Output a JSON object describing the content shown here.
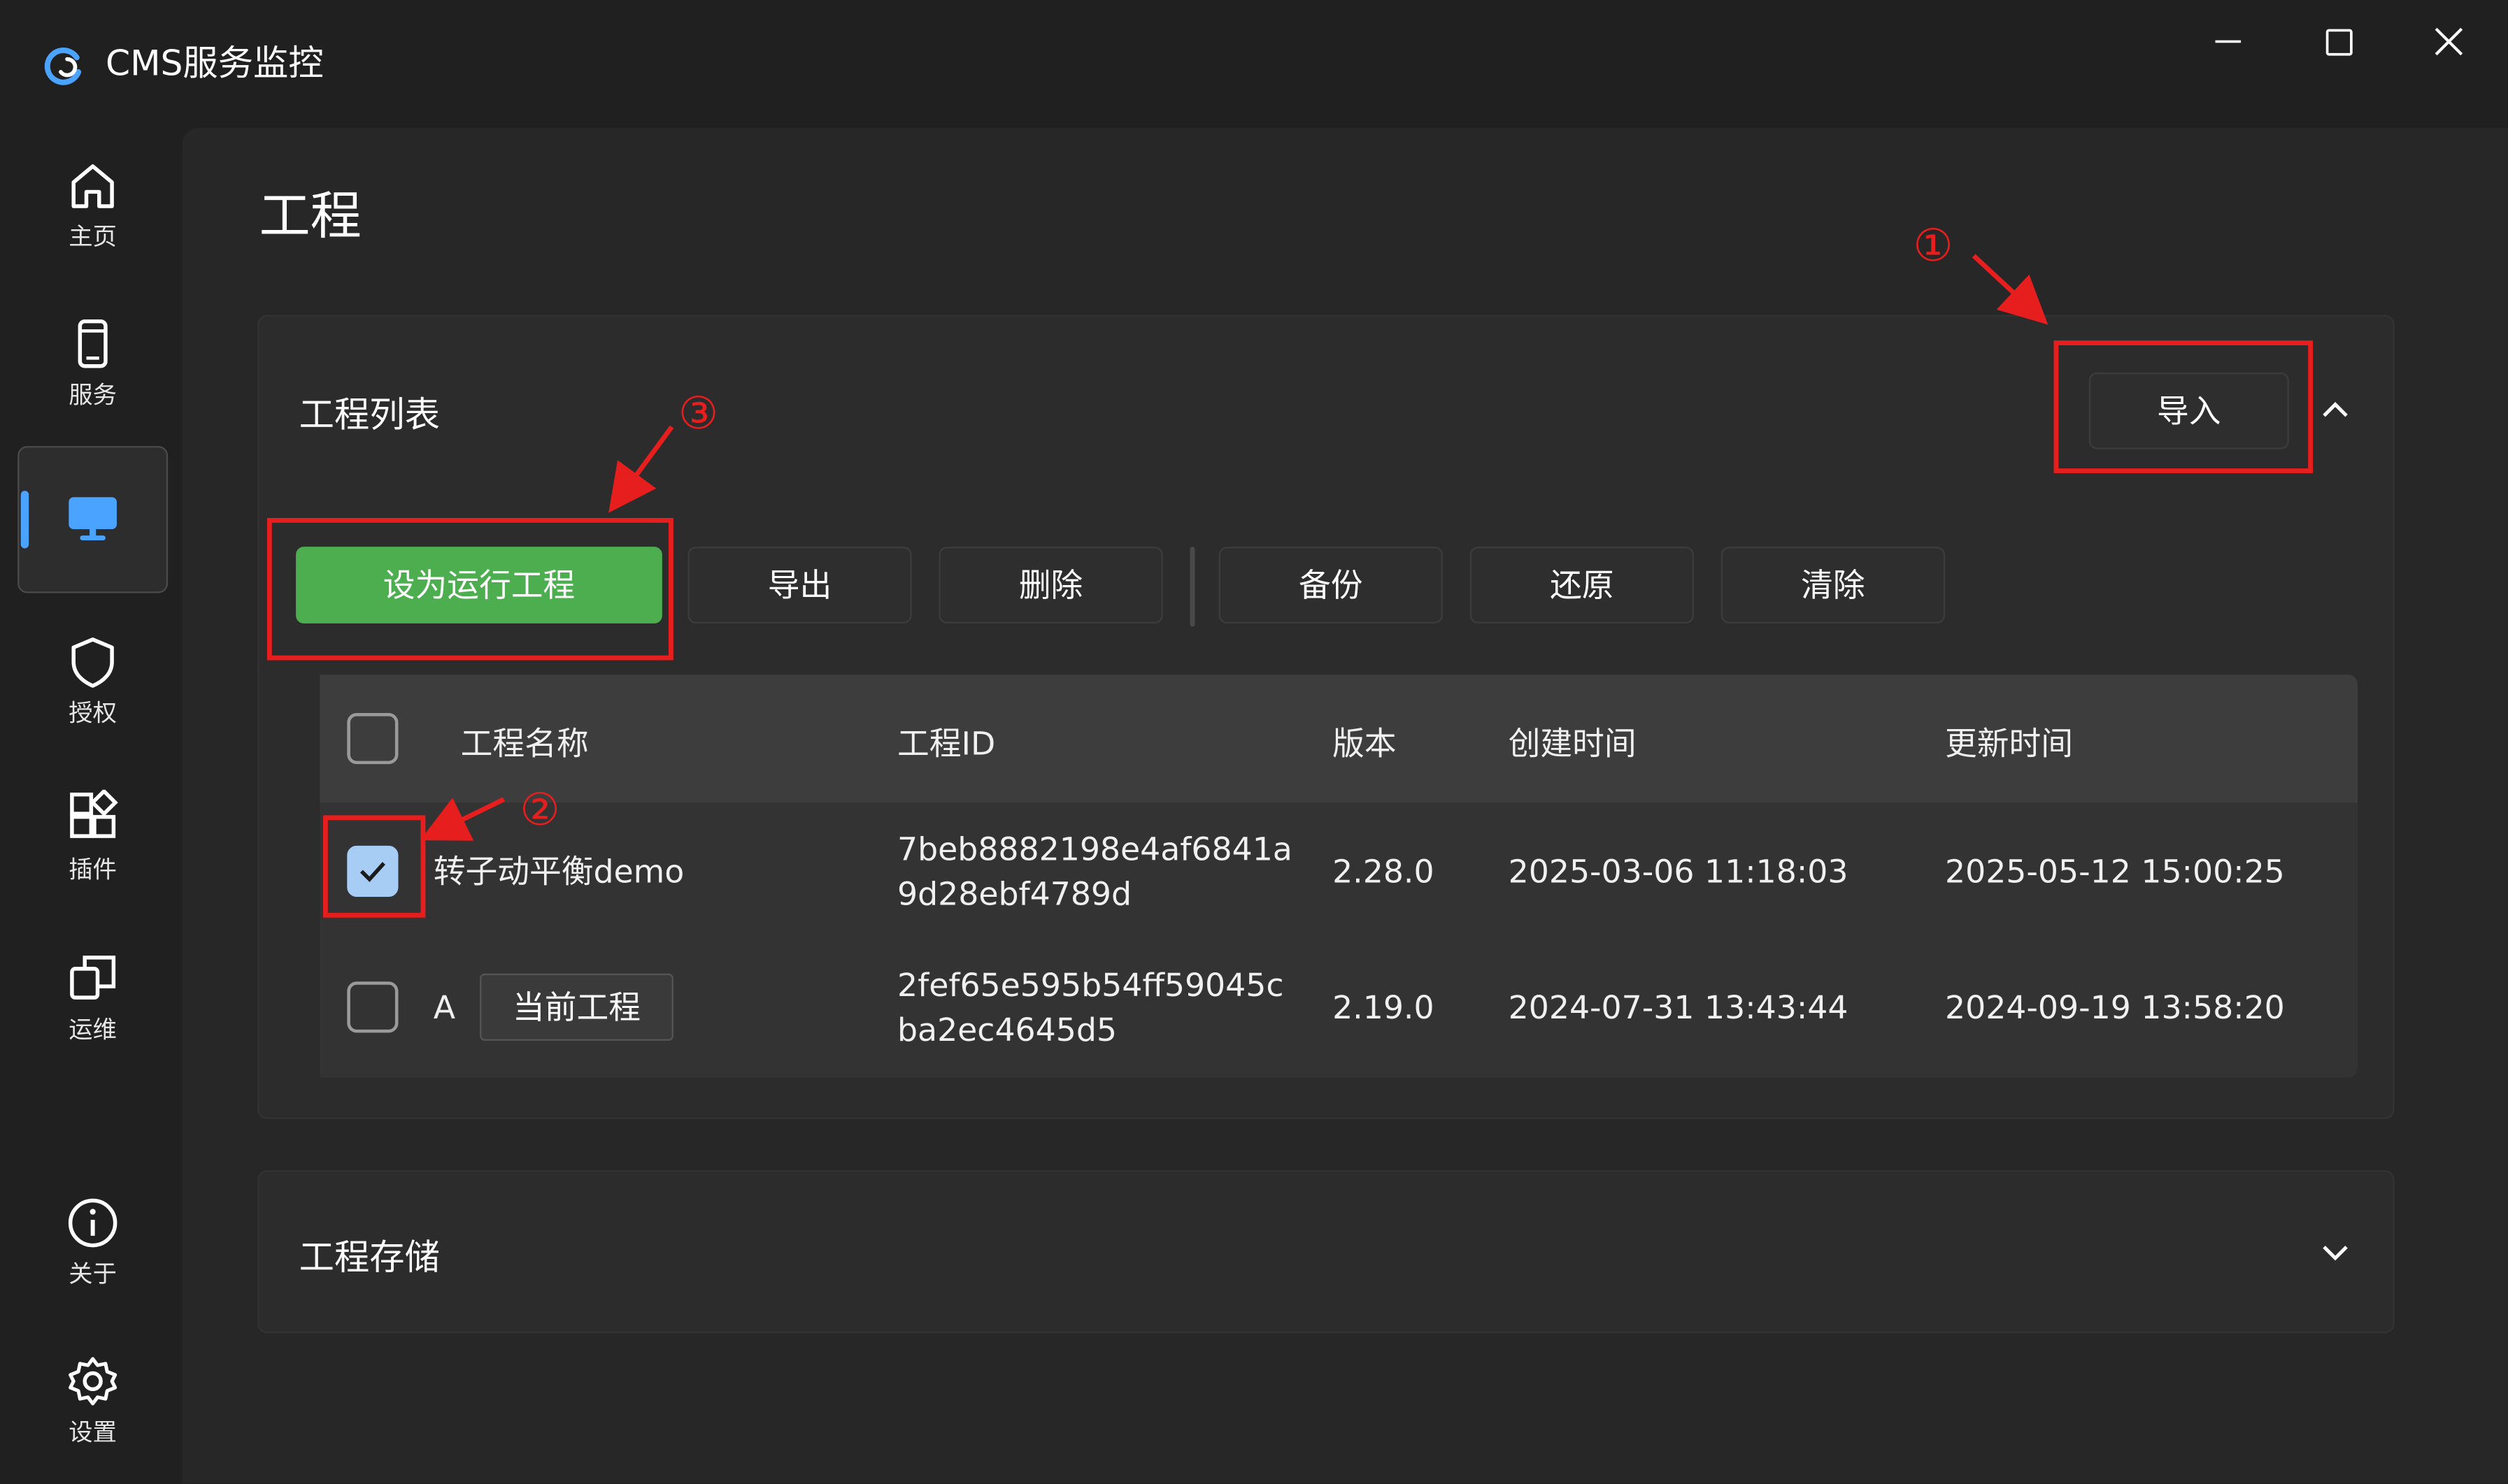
{
  "app": {
    "title": "CMS服务监控"
  },
  "window_controls": {
    "minimize": "minimize-icon",
    "maximize": "maximize-icon",
    "close": "close-icon"
  },
  "sidebar": {
    "items": [
      {
        "label": "主页",
        "icon": "home-icon"
      },
      {
        "label": "服务",
        "icon": "phone-icon"
      },
      {
        "label": "",
        "icon": "monitor-icon",
        "active": true
      },
      {
        "label": "授权",
        "icon": "shield-icon"
      },
      {
        "label": "插件",
        "icon": "plugin-icon"
      },
      {
        "label": "运维",
        "icon": "ops-icon"
      },
      {
        "label": "关于",
        "icon": "info-icon"
      },
      {
        "label": "设置",
        "icon": "gear-icon"
      }
    ]
  },
  "page": {
    "title": "工程"
  },
  "project_list": {
    "title": "工程列表",
    "import_label": "导入",
    "toolbar": {
      "set_running_label": "设为运行工程",
      "export_label": "导出",
      "delete_label": "删除",
      "backup_label": "备份",
      "restore_label": "还原",
      "clear_label": "清除"
    },
    "columns": [
      "工程名称",
      "工程ID",
      "版本",
      "创建时间",
      "更新时间"
    ],
    "rows": [
      {
        "checked": true,
        "name": "转子动平衡demo",
        "id_line1": "7beb8882198e4af6841a",
        "id_line2": "9d28ebf4789d",
        "version": "2.28.0",
        "created": "2025-03-06 11:18:03",
        "updated": "2025-05-12 15:00:25"
      },
      {
        "checked": false,
        "name": "A",
        "badge": "当前工程",
        "id_line1": "2fef65e595b54ff59045c",
        "id_line2": "ba2ec4645d5",
        "version": "2.19.0",
        "created": "2024-07-31 13:43:44",
        "updated": "2024-09-19 13:58:20"
      }
    ]
  },
  "project_storage": {
    "title": "工程存储"
  },
  "annotations": {
    "one": "①",
    "two": "②",
    "three": "③"
  },
  "colors": {
    "accent_green": "#4cae4f",
    "annotation_red": "#e61e1e",
    "checkbox_blue": "#a8cdf5",
    "active_indicator": "#4aa3ff"
  }
}
